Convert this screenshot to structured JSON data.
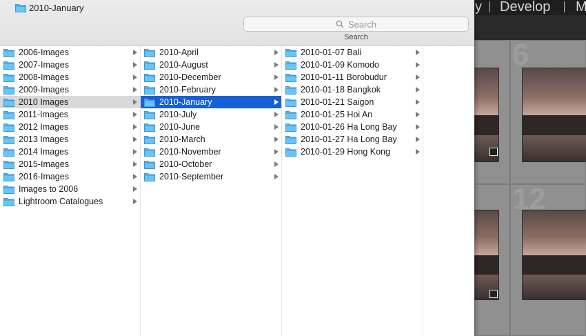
{
  "window": {
    "path_label": "2010-January",
    "search_placeholder": "Search",
    "search_caption": "Search"
  },
  "lightroom": {
    "modules": [
      "y",
      "Develop",
      "M"
    ],
    "cell_numbers": [
      "6",
      "12"
    ]
  },
  "columns": [
    {
      "name": "root",
      "items": [
        {
          "label": "2006-Images",
          "state": ""
        },
        {
          "label": "2007-Images",
          "state": ""
        },
        {
          "label": "2008-Images",
          "state": ""
        },
        {
          "label": "2009-Images",
          "state": ""
        },
        {
          "label": "2010 Images",
          "state": "grey"
        },
        {
          "label": "2011-Images",
          "state": ""
        },
        {
          "label": "2012 Images",
          "state": ""
        },
        {
          "label": "2013 Images",
          "state": ""
        },
        {
          "label": "2014 Images",
          "state": ""
        },
        {
          "label": "2015-Images",
          "state": ""
        },
        {
          "label": "2016-Images",
          "state": ""
        },
        {
          "label": "Images to 2006",
          "state": ""
        },
        {
          "label": "Lightroom Catalogues",
          "state": ""
        }
      ]
    },
    {
      "name": "2010 Images",
      "items": [
        {
          "label": "2010-April",
          "state": ""
        },
        {
          "label": "2010-August",
          "state": ""
        },
        {
          "label": "2010-December",
          "state": ""
        },
        {
          "label": "2010-February",
          "state": ""
        },
        {
          "label": "2010-January",
          "state": "blue"
        },
        {
          "label": "2010-July",
          "state": ""
        },
        {
          "label": "2010-June",
          "state": ""
        },
        {
          "label": "2010-March",
          "state": ""
        },
        {
          "label": "2010-November",
          "state": ""
        },
        {
          "label": "2010-October",
          "state": ""
        },
        {
          "label": "2010-September",
          "state": ""
        }
      ]
    },
    {
      "name": "2010-January",
      "items": [
        {
          "label": "2010-01-07 Bali",
          "state": ""
        },
        {
          "label": "2010-01-09 Komodo",
          "state": ""
        },
        {
          "label": "2010-01-11 Borobudur",
          "state": ""
        },
        {
          "label": "2010-01-18 Bangkok",
          "state": ""
        },
        {
          "label": "2010-01-21 Saigon",
          "state": ""
        },
        {
          "label": "2010-01-25 Hoi An",
          "state": ""
        },
        {
          "label": "2010-01-26 Ha Long Bay",
          "state": ""
        },
        {
          "label": "2010-01-27 Ha Long Bay",
          "state": ""
        },
        {
          "label": "2010-01-29 Hong Kong",
          "state": ""
        }
      ]
    },
    {
      "name": "empty",
      "items": []
    }
  ],
  "colors": {
    "selection_blue": "#1660d6",
    "selection_grey": "#d9d9d9",
    "folder_blue": "#5cb8f0"
  },
  "icons": {
    "folder": "folder-icon",
    "disclosure": "chevron-right-icon",
    "search": "search-icon"
  }
}
